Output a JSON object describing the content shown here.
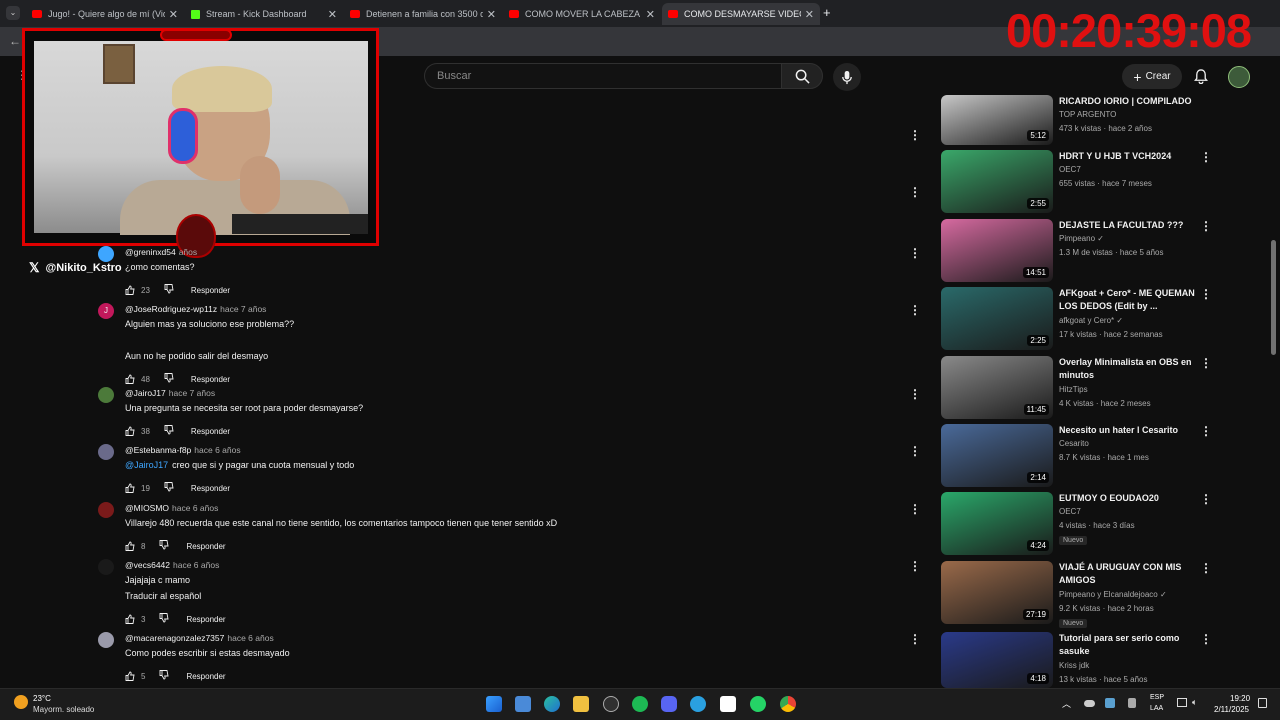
{
  "browser": {
    "tabs": [
      {
        "title": "Jugo! - Quiere algo de mí (Vide",
        "favicon": "youtube",
        "active": false
      },
      {
        "title": "Stream - Kick Dashboard",
        "favicon": "kick",
        "active": false
      },
      {
        "title": "Detienen a familia con 3500 do",
        "favicon": "youtube",
        "active": false
      },
      {
        "title": "COMO MOVER LA CABEZA SO",
        "favicon": "youtube",
        "active": false
      },
      {
        "title": "COMO DESMAYARSE VIDEO TU",
        "favicon": "youtube",
        "active": true
      }
    ],
    "new_tab_glyph": "+"
  },
  "overlay": {
    "timer": "00:20:39:08",
    "x_handle": "@Nikito_Kstro",
    "timer_color": "#e01010",
    "frame_color": "#e00000"
  },
  "header": {
    "search_placeholder": "Buscar",
    "create_label": "Crear"
  },
  "comments": [
    {
      "author": "@greninxd54",
      "when": "años",
      "lines": [
        "¿omo comentas?"
      ],
      "likes": "23",
      "reply_label": "Responder",
      "avatar_color": "#3ea6ff"
    },
    {
      "author": "@JoseRodriguez-wp11z",
      "when": "hace 7 años",
      "lines": [
        "Alguien mas ya soluciono ese problema??",
        "",
        "Aun no he podido salir del desmayo"
      ],
      "likes": "48",
      "reply_label": "Responder",
      "avatar_color": "#c2185b",
      "avatar_letter": "J"
    },
    {
      "author": "@JairoJ17",
      "when": "hace 7 años",
      "lines": [
        "Una pregunta se necesita ser root para poder desmayarse?"
      ],
      "likes": "38",
      "reply_label": "Responder",
      "avatar_color": "#4c7a3a"
    },
    {
      "author": "@Estebanma-f8p",
      "when": "hace 6 años",
      "mention": "@JairoJ17",
      "lines": [
        "creo que si y pagar una cuota mensual y todo"
      ],
      "likes": "19",
      "reply_label": "Responder",
      "avatar_color": "#6a6a8a"
    },
    {
      "author": "@MIOSMO",
      "when": "hace 6 años",
      "lines": [
        "Villarejo 480 recuerda que este canal no tiene sentido, los comentarios tampoco tienen que tener sentido xD"
      ],
      "likes": "8",
      "reply_label": "Responder",
      "avatar_color": "#7a1a1a"
    },
    {
      "author": "@vecs6442",
      "when": "hace 6 años",
      "lines": [
        "Jajajaja c mamo",
        "Traducir al español"
      ],
      "likes": "3",
      "reply_label": "Responder",
      "avatar_color": "#1a1a1a"
    },
    {
      "author": "@macarenagonzalez7357",
      "when": "hace 6 años",
      "lines": [
        "Como podes escribir si estas desmayado"
      ],
      "likes": "5",
      "reply_label": "Responder",
      "avatar_color": "#9a9aaa"
    }
  ],
  "sidebar_videos": [
    {
      "title": "RICARDO IORIO | COMPILADO",
      "channel": "TOP ARGENTO",
      "meta": "473 k vistas · hace 2 años",
      "duration": "5:12",
      "thumb_color": "#c8c8c8",
      "verified": false
    },
    {
      "title": "HDRT Y U HJB T VCH2024",
      "channel": "OEC7",
      "meta": "655 vistas · hace 7 meses",
      "duration": "2:55",
      "thumb_color": "#3aa86a",
      "verified": false
    },
    {
      "title": "DEJASTE LA FACULTAD ???",
      "channel": "Pimpeano",
      "meta": "1.3 M de vistas · hace 5 años",
      "duration": "14:51",
      "thumb_color": "#d66aa0",
      "verified": true
    },
    {
      "title": "AFKgoat + Cero* - ME QUEMAN LOS DEDOS (Edit by ...",
      "channel": "afkgoat y Cero*",
      "meta": "17 k vistas · hace 2 semanas",
      "duration": "2:25",
      "thumb_color": "#2a6a6a",
      "verified": true
    },
    {
      "title": "Overlay Minimalista en OBS en minutos",
      "channel": "HitzTips",
      "meta": "4 K vistas · hace 2 meses",
      "duration": "11:45",
      "thumb_color": "#8a8a8a",
      "verified": false
    },
    {
      "title": "Necesito un hater l Cesarito",
      "channel": "Cesarito",
      "meta": "8.7 K vistas · hace 1 mes",
      "duration": "2:14",
      "thumb_color": "#4a6a9a",
      "verified": false
    },
    {
      "title": "EUTMOY O EOUDAO20",
      "channel": "OEC7",
      "meta": "4 vistas · hace 3 días",
      "duration": "4:24",
      "thumb_color": "#2aa86a",
      "verified": false,
      "badge": "Nuevo"
    },
    {
      "title": "VIAJÉ A URUGUAY CON MIS AMIGOS",
      "channel": "Pimpeano y Elcanaldejoaco",
      "meta": "9.2 K vistas · hace 2 horas",
      "duration": "27:19",
      "thumb_color": "#9a6a4a",
      "verified": true,
      "badge": "Nuevo"
    },
    {
      "title": "Tutorial para ser serio como sasuke",
      "channel": "Kriss jdk",
      "meta": "13 k vistas · hace 5 años",
      "duration": "4:18",
      "thumb_color": "#2a3a8a",
      "verified": false
    }
  ],
  "taskbar": {
    "weather_temp": "23°C",
    "weather_desc": "Mayorm. soleado",
    "lang_top": "ESP",
    "lang_bottom": "LAA",
    "time": "19:20",
    "date": "2/11/2025"
  }
}
